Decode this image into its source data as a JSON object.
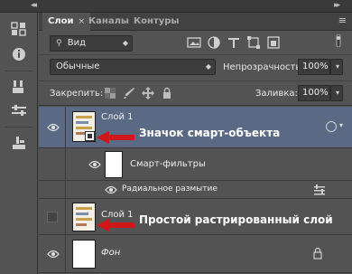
{
  "tabs": [
    {
      "label": "Слои",
      "active": true,
      "close": "×"
    },
    {
      "label": "Каналы",
      "active": false
    },
    {
      "label": "Контуры",
      "active": false
    }
  ],
  "panel_menu": "≡",
  "filter": {
    "label": "Вид",
    "icon": "search-icon"
  },
  "filter_icons": [
    "image-filter-icon",
    "adjustment-filter-icon",
    "text-filter-icon",
    "shape-filter-icon",
    "smart-object-filter-icon",
    "filter-toggle-icon"
  ],
  "blend_mode": "Обычные",
  "opacity": {
    "label": "Непрозрачность:",
    "value": "100%"
  },
  "lock": {
    "label": "Закрепить:"
  },
  "fill": {
    "label": "Заливка:",
    "value": "100%"
  },
  "layers": [
    {
      "name": "Слой 1",
      "type": "smart-object",
      "selected": true,
      "annotation": "Значок смарт-объекта"
    },
    {
      "name": "Смарт-фильтры",
      "type": "smart-filters-mask"
    },
    {
      "name": "Радиальное размытие",
      "type": "filter-entry"
    },
    {
      "name": "Слой 1",
      "type": "raster",
      "visible": false,
      "annotation": "Простой растрированный слой"
    },
    {
      "name": "Фон",
      "type": "background",
      "locked": true
    }
  ],
  "colors": {
    "accent_selected": "#5b6a84",
    "annotation_arrow": "#d01818"
  }
}
